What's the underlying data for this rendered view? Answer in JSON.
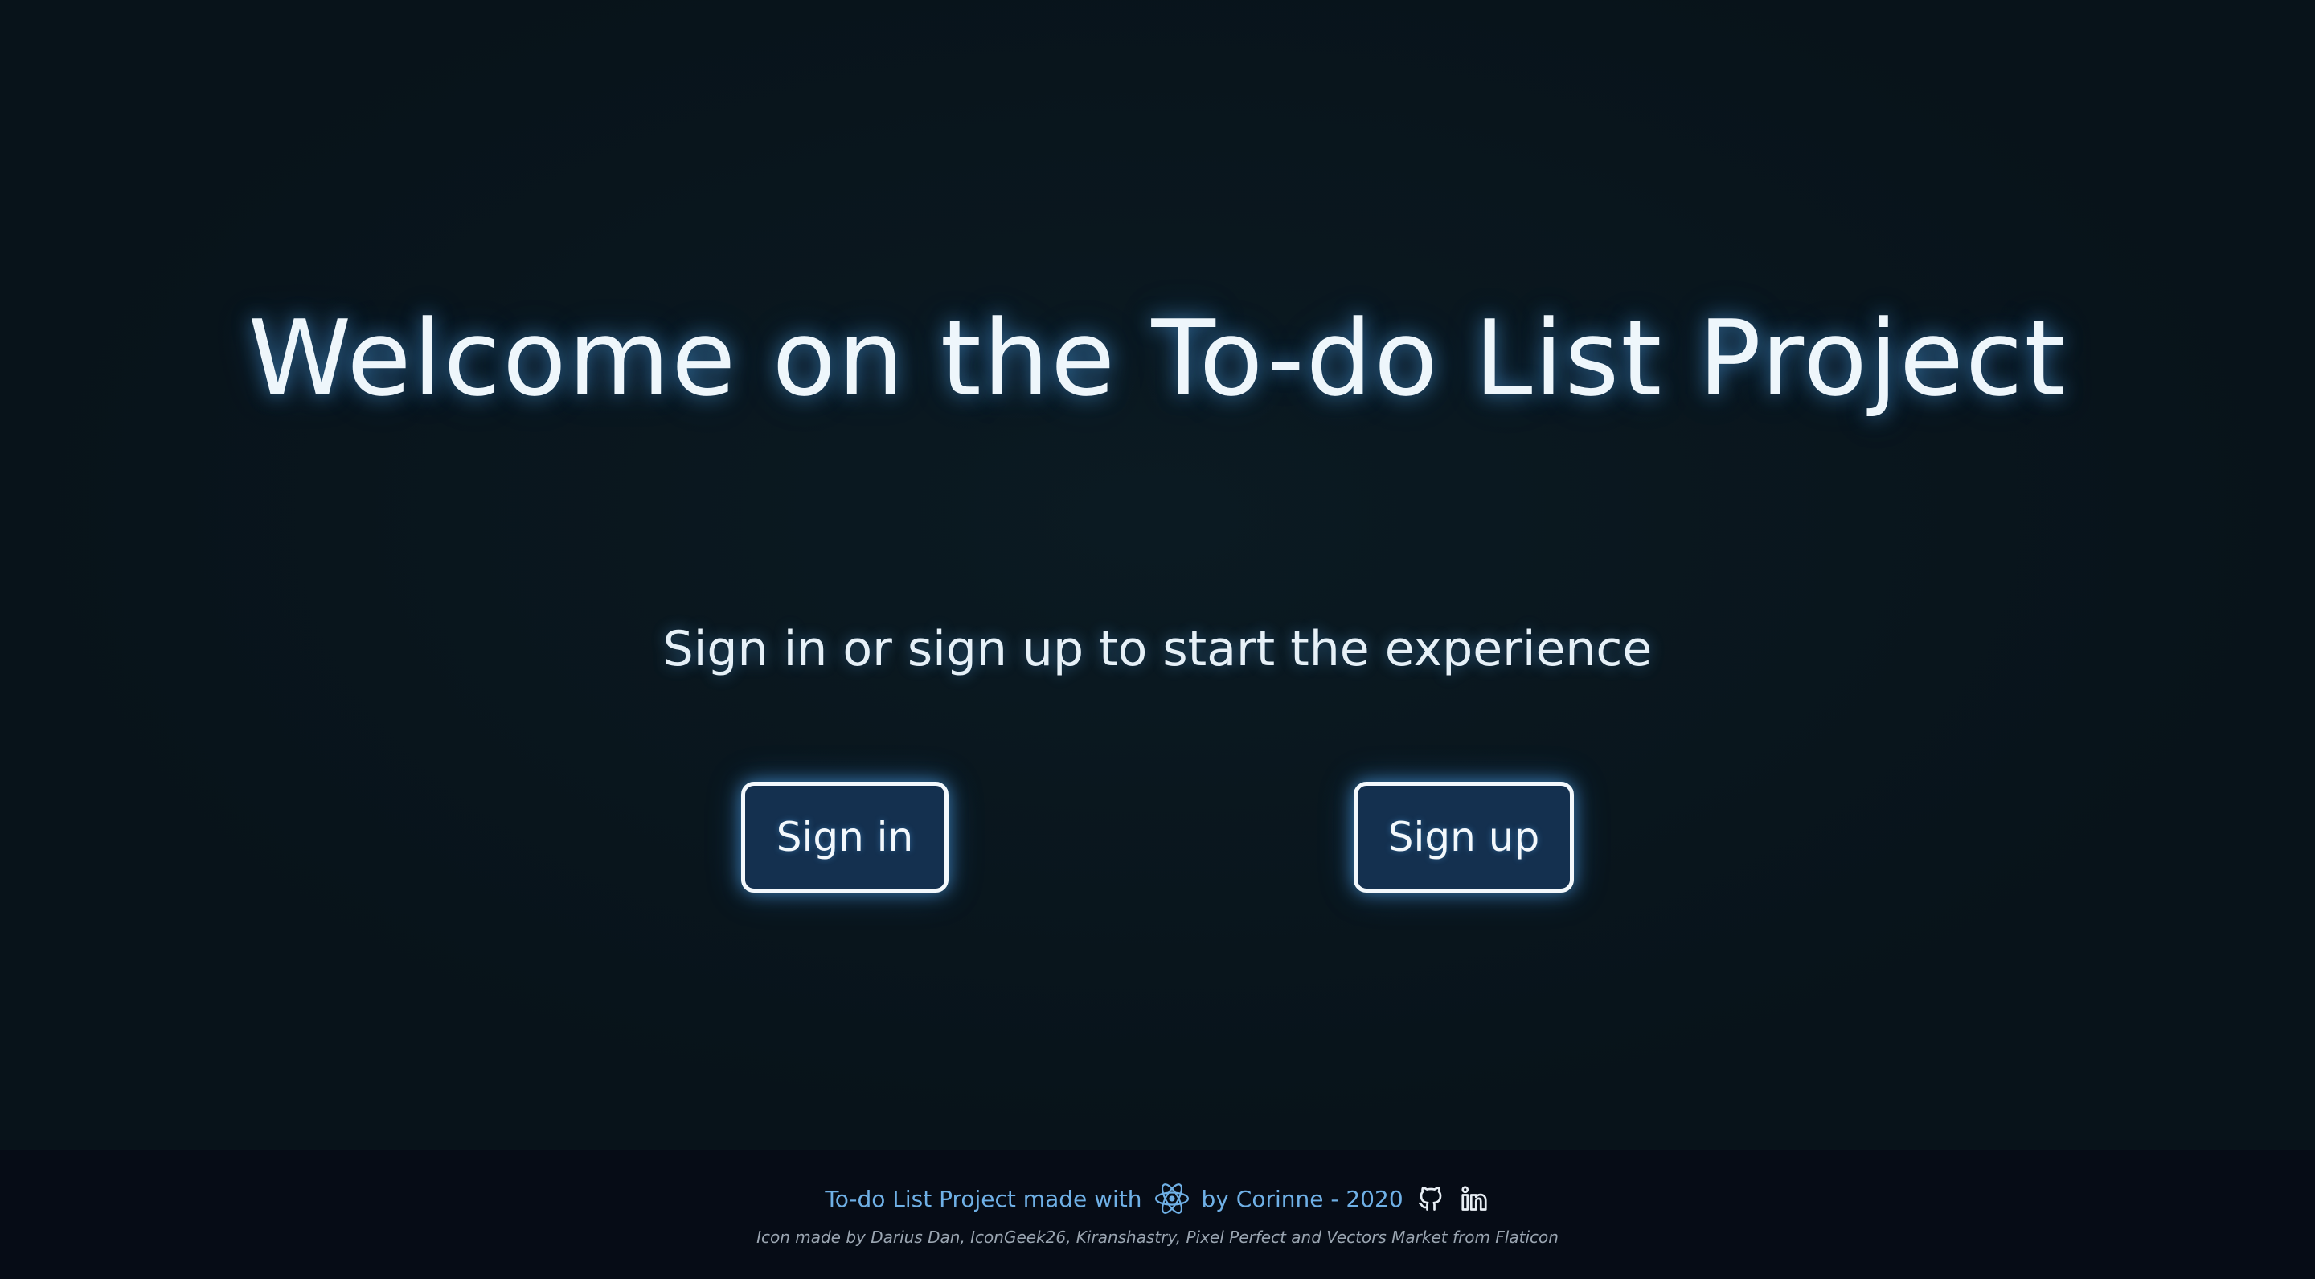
{
  "hero": {
    "title": "Welcome on the To-do List Project",
    "subtitle": "Sign in or sign up to start the experience"
  },
  "actions": {
    "sign_in_label": "Sign in",
    "sign_up_label": "Sign up"
  },
  "footer": {
    "made_with": "To-do List Project made with",
    "by_author": "by Corinne - 2020",
    "attribution": "Icon made by Darius Dan, IconGeek26, Kiranshastry, Pixel Perfect and Vectors Market from Flaticon",
    "icons": [
      "react-icon",
      "github-icon",
      "linkedin-icon"
    ]
  },
  "colors": {
    "background": "#08131a",
    "footer_background": "#060c16",
    "button_fill": "#14304f",
    "glow": "#5ab4ff",
    "footer_text": "#6fb0e6"
  }
}
